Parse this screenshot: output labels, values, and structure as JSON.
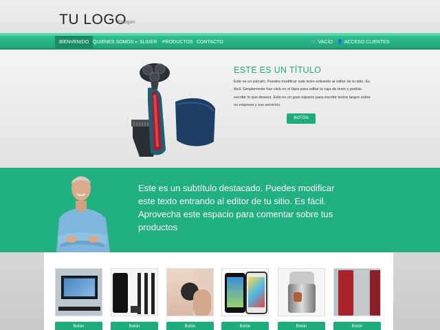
{
  "header": {
    "logo": "TU LOGO",
    "slogan": "Eslogan"
  },
  "nav": {
    "items": [
      {
        "label": "Bienvenido",
        "active": true
      },
      {
        "label": "Quienes somos",
        "dropdown": true
      },
      {
        "label": "Slider"
      },
      {
        "label": "Productos"
      },
      {
        "label": "Contacto"
      }
    ],
    "right": [
      {
        "label": "Vacío",
        "icon": "cart-icon"
      },
      {
        "label": "Acceso clientes",
        "icon": "user-icon"
      }
    ]
  },
  "hero": {
    "title": "Este es un título",
    "text": "Este es un párrafo. Puedes modificar este texto entrando al editor de tu sitio. Es fácil. Simplemente haz click en el lápiz para editar la caja de texto y podrás escribir lo que desees. Este es un gran espacio para escribir textos largos sobre su empresa y sus servicios.",
    "button": "Botón"
  },
  "banner": {
    "text": "Este es un subtítulo destacado. Puedes modificar este texto entrando al editor de tu sitio. Es fácil. Aprovecha este espacio para comentar sobre tus productos"
  },
  "products": [
    {
      "button": "Botón"
    },
    {
      "button": "Botón"
    },
    {
      "button": "Botón"
    },
    {
      "button": "Botón"
    },
    {
      "button": "Botón"
    },
    {
      "button": "Botón"
    }
  ],
  "colors": {
    "accent": "#1eac7c",
    "nav": "#21b07f"
  }
}
